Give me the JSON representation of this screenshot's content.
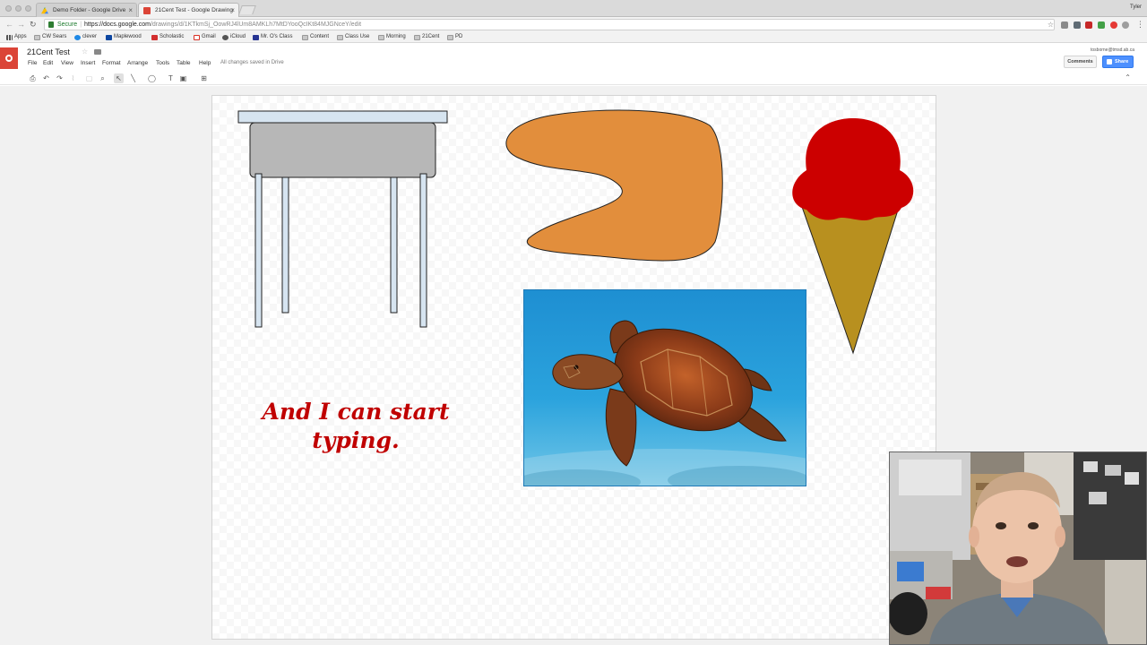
{
  "browser": {
    "tabs": [
      {
        "title": "Demo Folder - Google Drive",
        "active": false
      },
      {
        "title": "21Cent Test - Google Drawing",
        "active": true
      }
    ],
    "user": "Tyler",
    "url": {
      "secure_label": "Secure",
      "host": "https://docs.google.com",
      "path": "/drawings/d/1KTkmSj_OowRJ4lUm8AMKLh7MtDYooQcIKt84MJGNceY/edit"
    },
    "bookmarks": [
      "Apps",
      "CW Sears",
      "clever",
      "Maplewood",
      "Scholastic",
      "Gmail",
      "iCloud",
      "Mr. O's Class",
      "Content",
      "Class Use",
      "Morning",
      "21Cent",
      "PD"
    ]
  },
  "app": {
    "document_title": "21Cent Test",
    "menus": [
      "File",
      "Edit",
      "View",
      "Insert",
      "Format",
      "Arrange",
      "Tools",
      "Table",
      "Help"
    ],
    "save_status": "All changes saved in Drive",
    "account": "tosborne@tmsd.ab.ca",
    "comments_label": "Comments",
    "share_label": "Share"
  },
  "canvas": {
    "text_box": [
      "And I can start",
      "typing."
    ],
    "colors": {
      "text": "#c00000",
      "table_top": "#d6e4f0",
      "table_apron": "#b7b7b7",
      "blob": "#e28e3c",
      "ice_cream_scoop": "#cc0000",
      "cone": "#b8901f"
    },
    "shapes": [
      "table-drawing",
      "orange-blob-shape",
      "ice-cream-cone-drawing",
      "sea-turtle-photo"
    ]
  },
  "icons": {
    "toolbar": [
      "print-icon",
      "undo-icon",
      "redo-icon",
      "paint-format-icon",
      "zoom-icon",
      "select-icon",
      "line-icon",
      "shape-icon",
      "textbox-icon",
      "image-icon",
      "comment-icon"
    ]
  }
}
